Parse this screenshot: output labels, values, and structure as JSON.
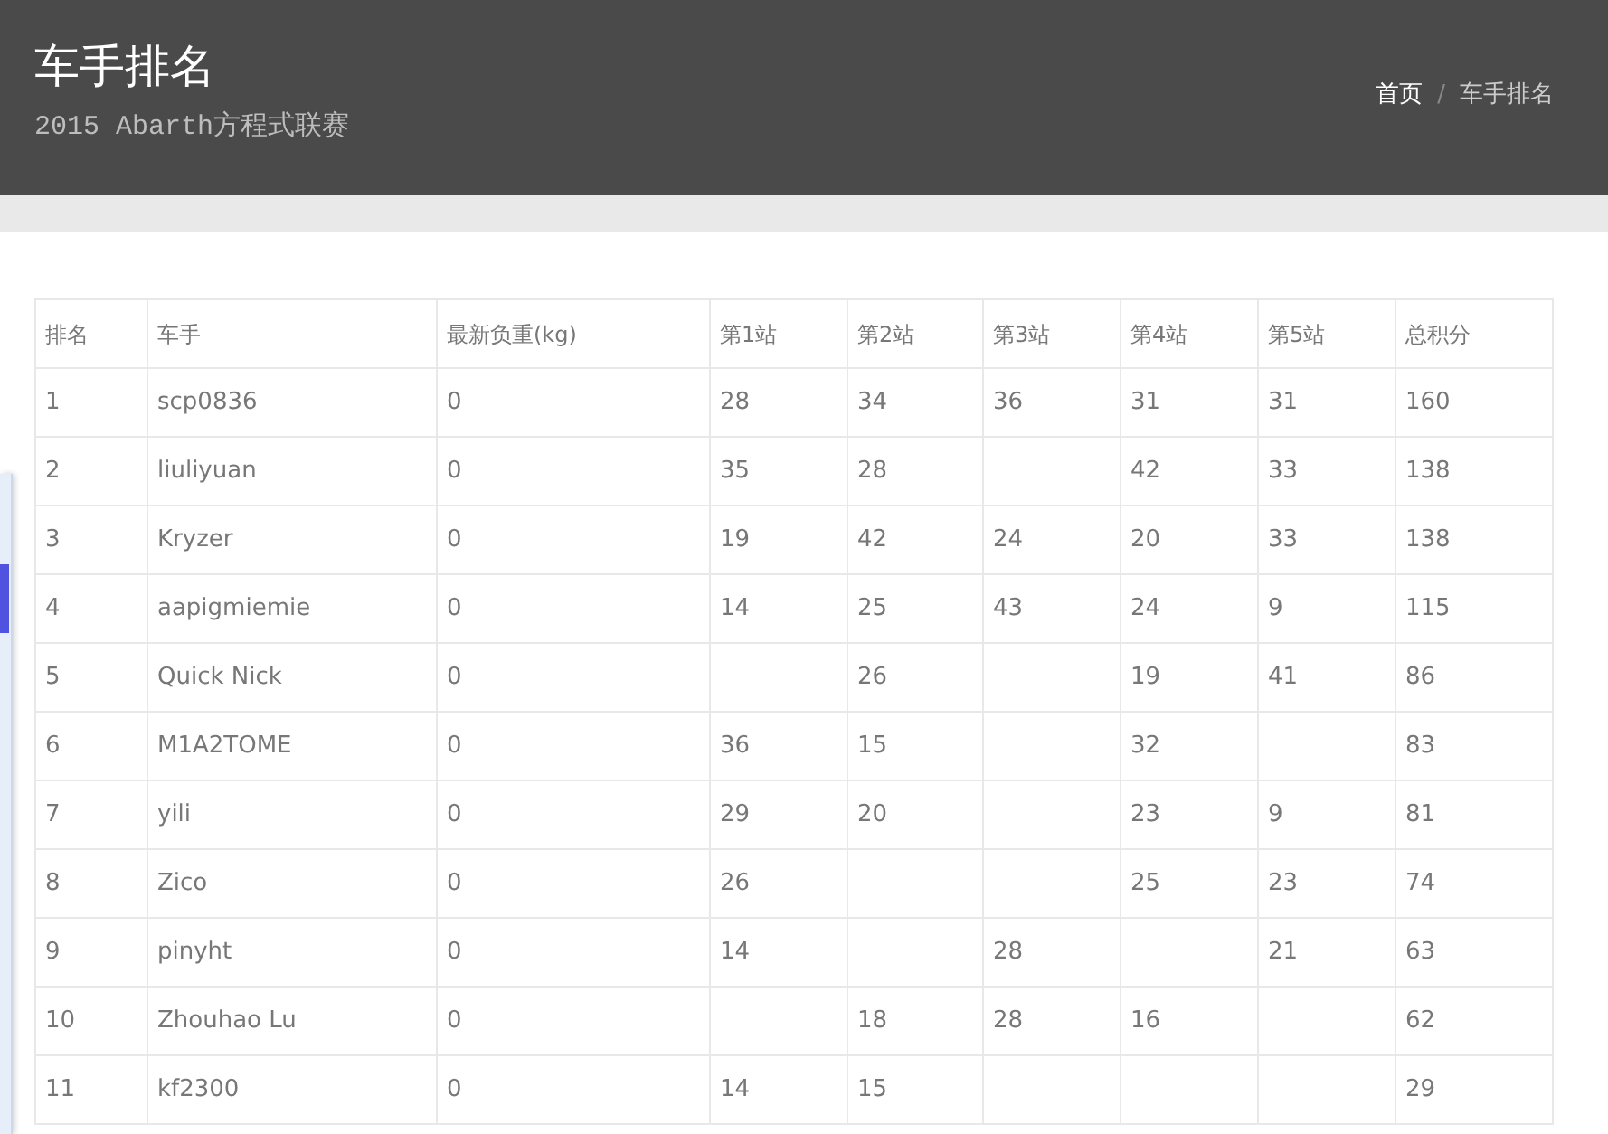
{
  "header": {
    "title": "车手排名",
    "subtitle": "2015 Abarth方程式联赛",
    "breadcrumb_separator": "/",
    "breadcrumb": [
      {
        "label": "首页",
        "selected": false
      },
      {
        "label": "车手排名",
        "selected": true
      }
    ]
  },
  "table": {
    "columns": [
      "排名",
      "车手",
      "最新负重(kg)",
      "第1站",
      "第2站",
      "第3站",
      "第4站",
      "第5站",
      "总积分"
    ],
    "rows": [
      [
        "1",
        "scp0836",
        "0",
        "28",
        "34",
        "36",
        "31",
        "31",
        "160"
      ],
      [
        "2",
        "liuliyuan",
        "0",
        "35",
        "28",
        "",
        "42",
        "33",
        "138"
      ],
      [
        "3",
        "Kryzer",
        "0",
        "19",
        "42",
        "24",
        "20",
        "33",
        "138"
      ],
      [
        "4",
        "aapigmiemie",
        "0",
        "14",
        "25",
        "43",
        "24",
        "9",
        "115"
      ],
      [
        "5",
        "Quick Nick",
        "0",
        "",
        "26",
        "",
        "19",
        "41",
        "86"
      ],
      [
        "6",
        "M1A2TOME",
        "0",
        "36",
        "15",
        "",
        "32",
        "",
        "83"
      ],
      [
        "7",
        "yili",
        "0",
        "29",
        "20",
        "",
        "23",
        "9",
        "81"
      ],
      [
        "8",
        "Zico",
        "0",
        "26",
        "",
        "",
        "25",
        "23",
        "74"
      ],
      [
        "9",
        "pinyht",
        "0",
        "14",
        "",
        "28",
        "",
        "21",
        "63"
      ],
      [
        "10",
        "Zhouhao Lu",
        "0",
        "",
        "18",
        "28",
        "16",
        "",
        "62"
      ],
      [
        "11",
        "kf2300",
        "0",
        "14",
        "15",
        "",
        "",
        "",
        "29"
      ]
    ]
  }
}
